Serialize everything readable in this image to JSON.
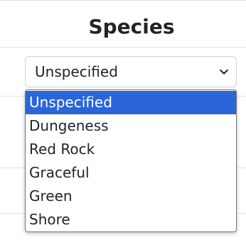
{
  "form": {
    "heading": "Species",
    "select": {
      "value": "Unspecified",
      "options": [
        {
          "label": "Unspecified",
          "selected": true
        },
        {
          "label": "Dungeness",
          "selected": false
        },
        {
          "label": "Red Rock",
          "selected": false
        },
        {
          "label": "Graceful",
          "selected": false
        },
        {
          "label": "Green",
          "selected": false
        },
        {
          "label": "Shore",
          "selected": false
        }
      ]
    }
  },
  "colors": {
    "selected_option_bg": "#2a66d9",
    "selected_option_text": "#ffffff",
    "text": "#212529",
    "border": "#ced4da"
  },
  "icons": {
    "select_chevron": "chevron-down-icon"
  }
}
